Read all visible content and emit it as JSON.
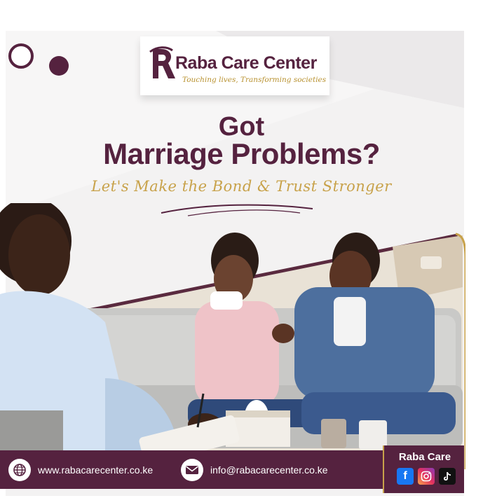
{
  "brand": {
    "name": "Raba Care Center",
    "tagline": "Touching lives, Transforming societies",
    "logo_icon": "raba-r-monogram"
  },
  "headline": {
    "line1": "Got",
    "line2": "Marriage Problems?",
    "subline": "Let's Make the Bond & Trust Stronger"
  },
  "photo": {
    "icon": "counseling-session-photo"
  },
  "footer": {
    "website_icon": "globe-icon",
    "website": "www.rabacarecenter.co.ke",
    "email_icon": "mail-icon",
    "email": "info@rabacarecenter.co.ke"
  },
  "social": {
    "title": "Raba Care",
    "icons": [
      "facebook-icon",
      "instagram-icon",
      "tiktok-icon"
    ]
  },
  "colors": {
    "brand_plum": "#55223f",
    "accent_gold": "#c8a24a",
    "background": "#f3f2f2"
  }
}
